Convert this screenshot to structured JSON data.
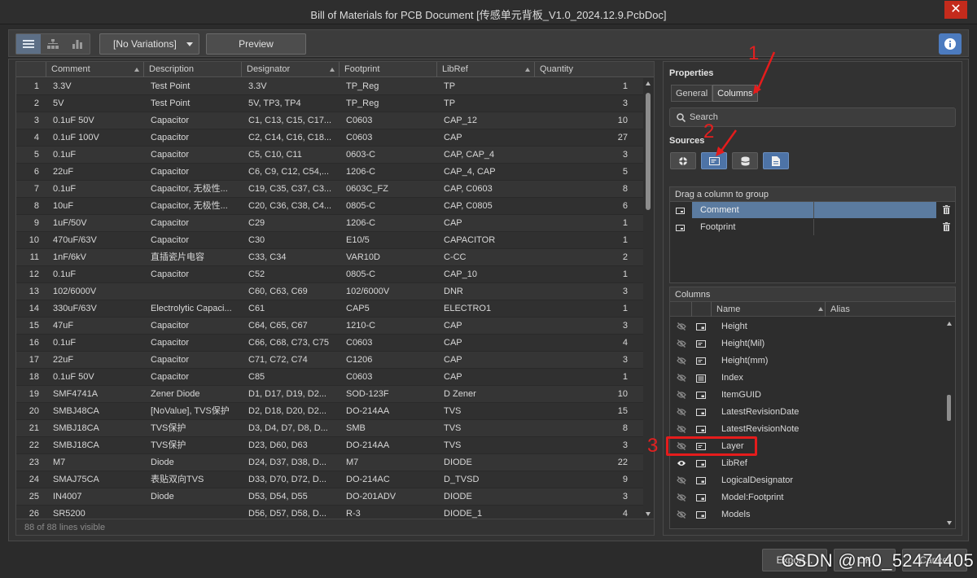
{
  "window": {
    "title": "Bill of Materials for PCB Document [传感单元背板_V1.0_2024.12.9.PcbDoc]",
    "close_glyph": "✕"
  },
  "toolbar": {
    "view_buttons": [
      "list-view-icon",
      "tree-view-icon",
      "chart-view-icon"
    ],
    "variations_value": "[No Variations]",
    "preview_label": "Preview",
    "info_icon": "info-icon"
  },
  "table": {
    "columns": [
      "Comment",
      "Description",
      "Designator",
      "Footprint",
      "LibRef",
      "Quantity"
    ],
    "rows": [
      {
        "n": "1",
        "comment": "3.3V",
        "description": "Test Point",
        "designator": "3.3V",
        "footprint": "TP_Reg",
        "libref": "TP",
        "qty": "1"
      },
      {
        "n": "2",
        "comment": "5V",
        "description": "Test Point",
        "designator": "5V, TP3, TP4",
        "footprint": "TP_Reg",
        "libref": "TP",
        "qty": "3"
      },
      {
        "n": "3",
        "comment": "0.1uF  50V",
        "description": "Capacitor",
        "designator": "C1, C13, C15, C17...",
        "footprint": "C0603",
        "libref": "CAP_12",
        "qty": "10"
      },
      {
        "n": "4",
        "comment": "0.1uF  100V",
        "description": "Capacitor",
        "designator": "C2, C14, C16, C18...",
        "footprint": "C0603",
        "libref": "CAP",
        "qty": "27"
      },
      {
        "n": "5",
        "comment": "0.1uF",
        "description": "Capacitor",
        "designator": "C5, C10, C11",
        "footprint": "0603-C",
        "libref": "CAP, CAP_4",
        "qty": "3"
      },
      {
        "n": "6",
        "comment": "22uF",
        "description": "Capacitor",
        "designator": "C6, C9, C12, C54,...",
        "footprint": "1206-C",
        "libref": "CAP_4, CAP",
        "qty": "5"
      },
      {
        "n": "7",
        "comment": "0.1uF",
        "description": "Capacitor, 无极性...",
        "designator": "C19, C35, C37, C3...",
        "footprint": "0603C_FZ",
        "libref": "CAP, C0603",
        "qty": "8"
      },
      {
        "n": "8",
        "comment": "10uF",
        "description": "Capacitor, 无极性...",
        "designator": "C20, C36, C38, C4...",
        "footprint": "0805-C",
        "libref": "CAP, C0805",
        "qty": "6"
      },
      {
        "n": "9",
        "comment": "1uF/50V",
        "description": "Capacitor",
        "designator": "C29",
        "footprint": "1206-C",
        "libref": "CAP",
        "qty": "1"
      },
      {
        "n": "10",
        "comment": "470uF/63V",
        "description": "Capacitor",
        "designator": "C30",
        "footprint": "E10/5",
        "libref": "CAPACITOR",
        "qty": "1"
      },
      {
        "n": "11",
        "comment": "1nF/6kV",
        "description": "直插瓷片电容",
        "designator": "C33, C34",
        "footprint": "VAR10D",
        "libref": "C-CC",
        "qty": "2"
      },
      {
        "n": "12",
        "comment": "0.1uF",
        "description": "Capacitor",
        "designator": "C52",
        "footprint": "0805-C",
        "libref": "CAP_10",
        "qty": "1"
      },
      {
        "n": "13",
        "comment": "102/6000V",
        "description": "",
        "designator": "C60, C63, C69",
        "footprint": "102/6000V",
        "libref": "DNR",
        "qty": "3"
      },
      {
        "n": "14",
        "comment": "330uF/63V",
        "description": "Electrolytic Capaci...",
        "designator": "C61",
        "footprint": "CAP5",
        "libref": "ELECTRO1",
        "qty": "1"
      },
      {
        "n": "15",
        "comment": "47uF",
        "description": "Capacitor",
        "designator": "C64, C65, C67",
        "footprint": "1210-C",
        "libref": "CAP",
        "qty": "3"
      },
      {
        "n": "16",
        "comment": "0.1uF",
        "description": "Capacitor",
        "designator": "C66, C68, C73, C75",
        "footprint": "C0603",
        "libref": "CAP",
        "qty": "4"
      },
      {
        "n": "17",
        "comment": "22uF",
        "description": "Capacitor",
        "designator": "C71, C72, C74",
        "footprint": "C1206",
        "libref": "CAP",
        "qty": "3"
      },
      {
        "n": "18",
        "comment": "0.1uF 50V",
        "description": "Capacitor",
        "designator": "C85",
        "footprint": "C0603",
        "libref": "CAP",
        "qty": "1"
      },
      {
        "n": "19",
        "comment": "SMF4741A",
        "description": "Zener Diode",
        "designator": "D1, D17, D19, D2...",
        "footprint": "SOD-123F",
        "libref": "D Zener",
        "qty": "10"
      },
      {
        "n": "20",
        "comment": "SMBJ48CA",
        "description": "[NoValue], TVS保护",
        "designator": "D2, D18, D20, D2...",
        "footprint": "DO-214AA",
        "libref": "TVS",
        "qty": "15"
      },
      {
        "n": "21",
        "comment": "SMBJ18CA",
        "description": "TVS保护",
        "designator": "D3, D4, D7, D8, D...",
        "footprint": "SMB",
        "libref": "TVS",
        "qty": "8"
      },
      {
        "n": "22",
        "comment": "SMBJ18CA",
        "description": "TVS保护",
        "designator": "D23, D60, D63",
        "footprint": "DO-214AA",
        "libref": "TVS",
        "qty": "3"
      },
      {
        "n": "23",
        "comment": "M7",
        "description": "Diode",
        "designator": "D24, D37, D38, D...",
        "footprint": "M7",
        "libref": "DIODE",
        "qty": "22"
      },
      {
        "n": "24",
        "comment": "SMAJ75CA",
        "description": "表贴双向TVS",
        "designator": "D33, D70, D72, D...",
        "footprint": "DO-214AC",
        "libref": "D_TVSD",
        "qty": "9"
      },
      {
        "n": "25",
        "comment": "IN4007",
        "description": "Diode",
        "designator": "D53, D54, D55",
        "footprint": "DO-201ADV",
        "libref": "DIODE",
        "qty": "3"
      },
      {
        "n": "26",
        "comment": "SR5200",
        "description": "",
        "designator": "D56, D57, D58, D...",
        "footprint": "R-3",
        "libref": "DIODE_1",
        "qty": "4"
      }
    ],
    "status": "88 of 88 lines visible"
  },
  "properties": {
    "title": "Properties",
    "tabs": [
      "General",
      "Columns"
    ],
    "search_placeholder": "Search",
    "sources_label": "Sources",
    "sources": [
      "components-source-icon",
      "pcb-parameters-source-icon",
      "database-source-icon",
      "document-source-icon"
    ],
    "group_title": "Drag a column to group",
    "group_rows": [
      "Comment",
      "Footprint"
    ],
    "columns_title": "Columns",
    "columns_headers": [
      "Name",
      "Alias"
    ],
    "columns_list": [
      {
        "name": "Height",
        "visible": false,
        "type": "parameter"
      },
      {
        "name": "Height(Mil)",
        "visible": false,
        "type": "pcb"
      },
      {
        "name": "Height(mm)",
        "visible": false,
        "type": "pcb"
      },
      {
        "name": "Index",
        "visible": false,
        "type": "document"
      },
      {
        "name": "ItemGUID",
        "visible": false,
        "type": "parameter"
      },
      {
        "name": "LatestRevisionDate",
        "visible": false,
        "type": "parameter"
      },
      {
        "name": "LatestRevisionNote",
        "visible": false,
        "type": "parameter"
      },
      {
        "name": "Layer",
        "visible": false,
        "type": "pcb"
      },
      {
        "name": "LibRef",
        "visible": true,
        "type": "parameter"
      },
      {
        "name": "LogicalDesignator",
        "visible": false,
        "type": "parameter"
      },
      {
        "name": "Model:Footprint",
        "visible": false,
        "type": "parameter"
      },
      {
        "name": "Models",
        "visible": false,
        "type": "parameter"
      }
    ]
  },
  "annotations": {
    "one": "1",
    "two": "2",
    "three": "3"
  },
  "bottom": {
    "export_label": "Export...",
    "ok_label": "OK",
    "cancel_label": "Cancel"
  },
  "watermark": "CSDN @m0_52474405"
}
